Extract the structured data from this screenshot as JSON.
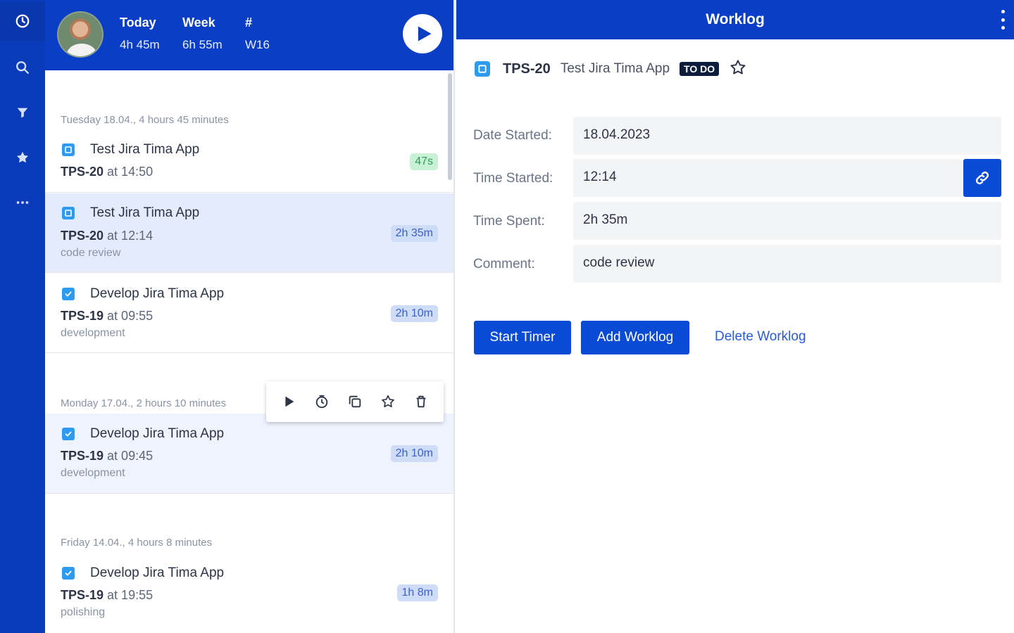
{
  "header": {
    "today_label": "Today",
    "today_value": "4h 45m",
    "week_label": "Week",
    "week_value": "6h 55m",
    "num_label": "#",
    "num_value": "W16"
  },
  "groups": [
    {
      "title": "Tuesday 18.04., 4 hours 45 minutes",
      "entries": [
        {
          "summary": "Test Jira Tima App",
          "key": "TPS-20",
          "at": "at 14:50",
          "comment": "",
          "duration": "47s",
          "icon": "story-icon"
        },
        {
          "summary": "Test Jira Tima App",
          "key": "TPS-20",
          "at": "at 12:14",
          "comment": "code review",
          "duration": "2h 35m",
          "icon": "story-icon"
        },
        {
          "summary": "Develop Jira Tima App",
          "key": "TPS-19",
          "at": "at 09:55",
          "comment": "development",
          "duration": "2h 10m",
          "icon": "task-icon"
        }
      ]
    },
    {
      "title": "Monday 17.04., 2 hours 10 minutes",
      "entries": [
        {
          "summary": "Develop Jira Tima App",
          "key": "TPS-19",
          "at": "at 09:45",
          "comment": "development",
          "duration": "2h 10m",
          "icon": "task-icon"
        }
      ]
    },
    {
      "title": "Friday 14.04., 4 hours 8 minutes",
      "entries": [
        {
          "summary": "Develop Jira Tima App",
          "key": "TPS-19",
          "at": "at 19:55",
          "comment": "polishing",
          "duration": "1h 8m",
          "icon": "task-icon"
        }
      ]
    }
  ],
  "detail": {
    "title": "Worklog",
    "issue_key": "TPS-20",
    "issue_name": "Test Jira Tima App",
    "status": "TO DO",
    "fields": {
      "date_started_label": "Date Started:",
      "date_started_value": "18.04.2023",
      "time_started_label": "Time Started:",
      "time_started_value": "12:14",
      "time_spent_label": "Time Spent:",
      "time_spent_value": "2h 35m",
      "comment_label": "Comment:",
      "comment_value": "code review"
    },
    "buttons": {
      "start_timer": "Start Timer",
      "add_worklog": "Add Worklog",
      "delete_worklog": "Delete Worklog"
    }
  },
  "colors": {
    "brand": "#0a3ec6",
    "accent": "#0a4bd6",
    "selected_row": "#e4ecfc",
    "status_badge": "#0b1c3c"
  }
}
